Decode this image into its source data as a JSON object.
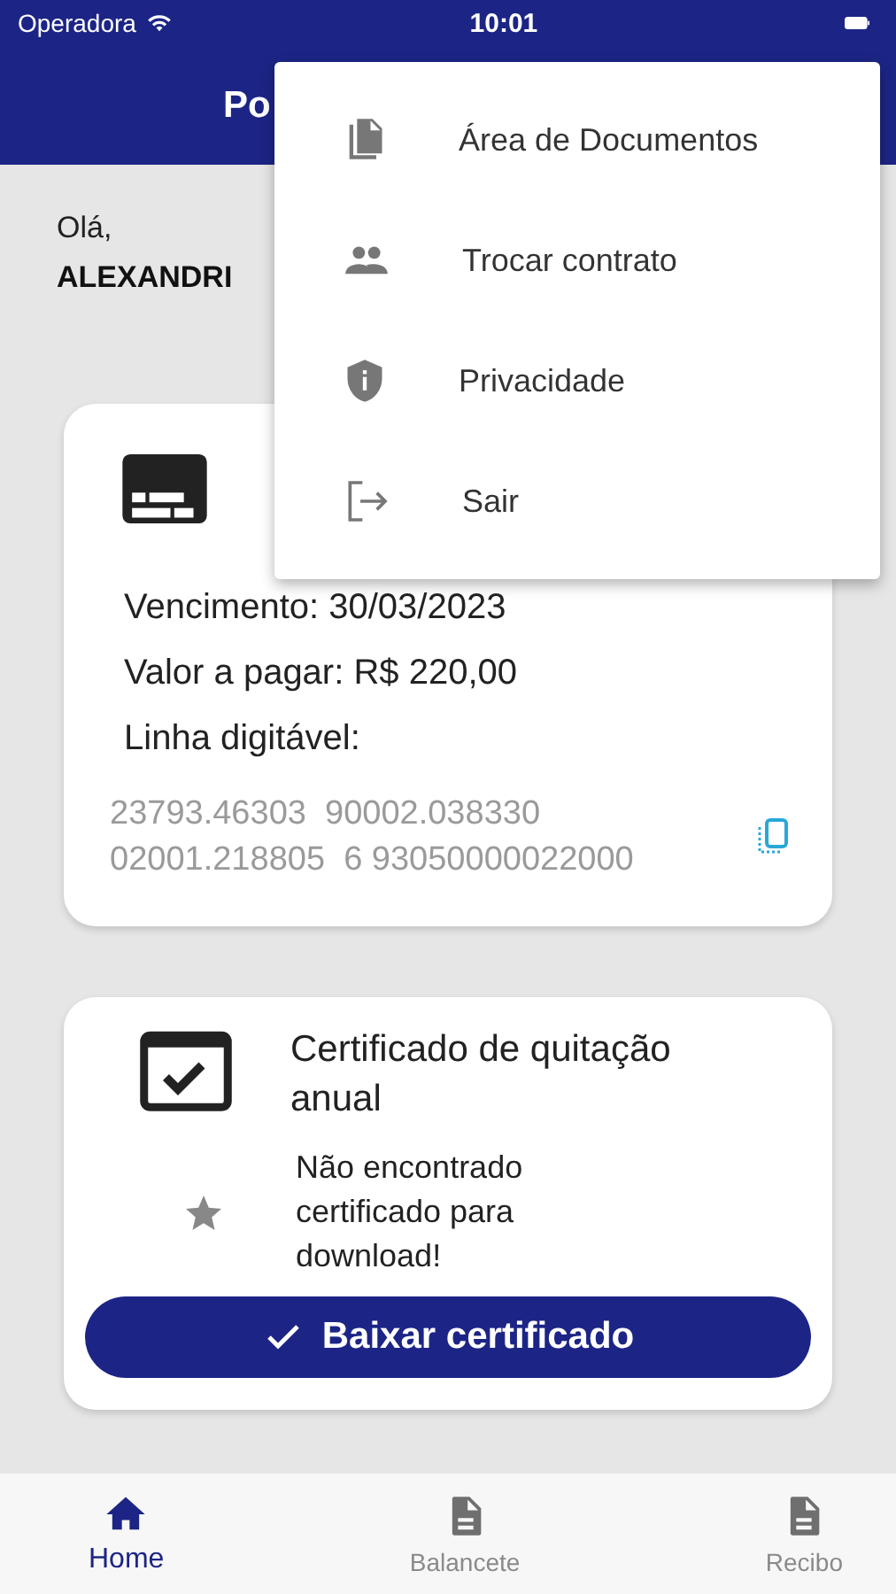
{
  "status_bar": {
    "carrier": "Operadora",
    "time": "10:01"
  },
  "header": {
    "title": "Po"
  },
  "greeting": {
    "hello": "Olá,",
    "name": "ALEXANDRI"
  },
  "bill_card": {
    "due": "Vencimento: 30/03/2023",
    "amount": "Valor a pagar: R$ 220,00",
    "line_label": "Linha digitável:",
    "line_value": "23793.46303  90002.038330 02001.218805  6 93050000022000"
  },
  "certificate_card": {
    "title": "Certificado de quitação anual",
    "message": "Não encontrado certificado para download!",
    "button": "Baixar certificado"
  },
  "menu": [
    {
      "kind": "documents",
      "label": "Área de Documentos"
    },
    {
      "kind": "people",
      "label": "Trocar contrato"
    },
    {
      "kind": "shield",
      "label": "Privacidade"
    },
    {
      "kind": "logout",
      "label": "Sair"
    }
  ],
  "tabs": [
    {
      "kind": "home",
      "label": "Home",
      "selected": true
    },
    {
      "kind": "doc",
      "label": "Balancete",
      "selected": false
    },
    {
      "kind": "doc",
      "label": "Recibo",
      "selected": false
    }
  ]
}
